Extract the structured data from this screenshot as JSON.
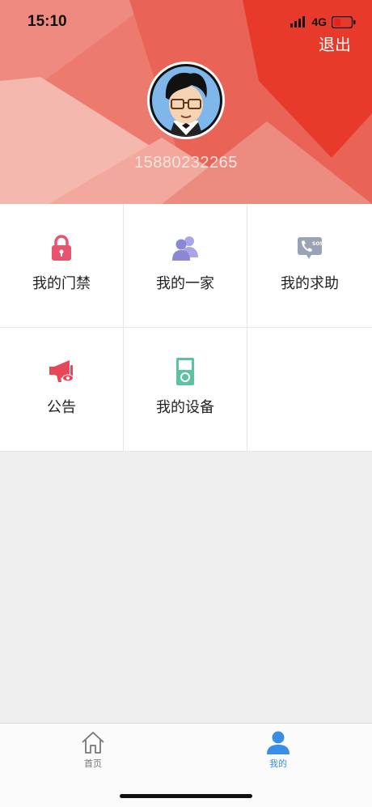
{
  "status_bar": {
    "time": "15:10",
    "network": "4G",
    "battery_level": 0.3
  },
  "header": {
    "logout_label": "退出",
    "phone_number": "15880232265",
    "colors": {
      "primary": "#e96a5e",
      "accent": "#e83a2a"
    }
  },
  "menu": {
    "items": [
      {
        "label": "我的门禁",
        "icon": "lock-icon",
        "color": "#e8546d"
      },
      {
        "label": "我的一家",
        "icon": "family-icon",
        "color": "#8b86d6"
      },
      {
        "label": "我的求助",
        "icon": "sos-icon",
        "color": "#9aa3b5"
      },
      {
        "label": "公告",
        "icon": "megaphone-icon",
        "color": "#e8475a"
      },
      {
        "label": "我的设备",
        "icon": "device-icon",
        "color": "#5cc2a0"
      }
    ]
  },
  "tabbar": {
    "tabs": [
      {
        "label": "首页",
        "icon": "home-icon",
        "active": false
      },
      {
        "label": "我的",
        "icon": "person-icon",
        "active": true
      }
    ],
    "active_color": "#3a8ee6",
    "inactive_color": "#777777"
  }
}
